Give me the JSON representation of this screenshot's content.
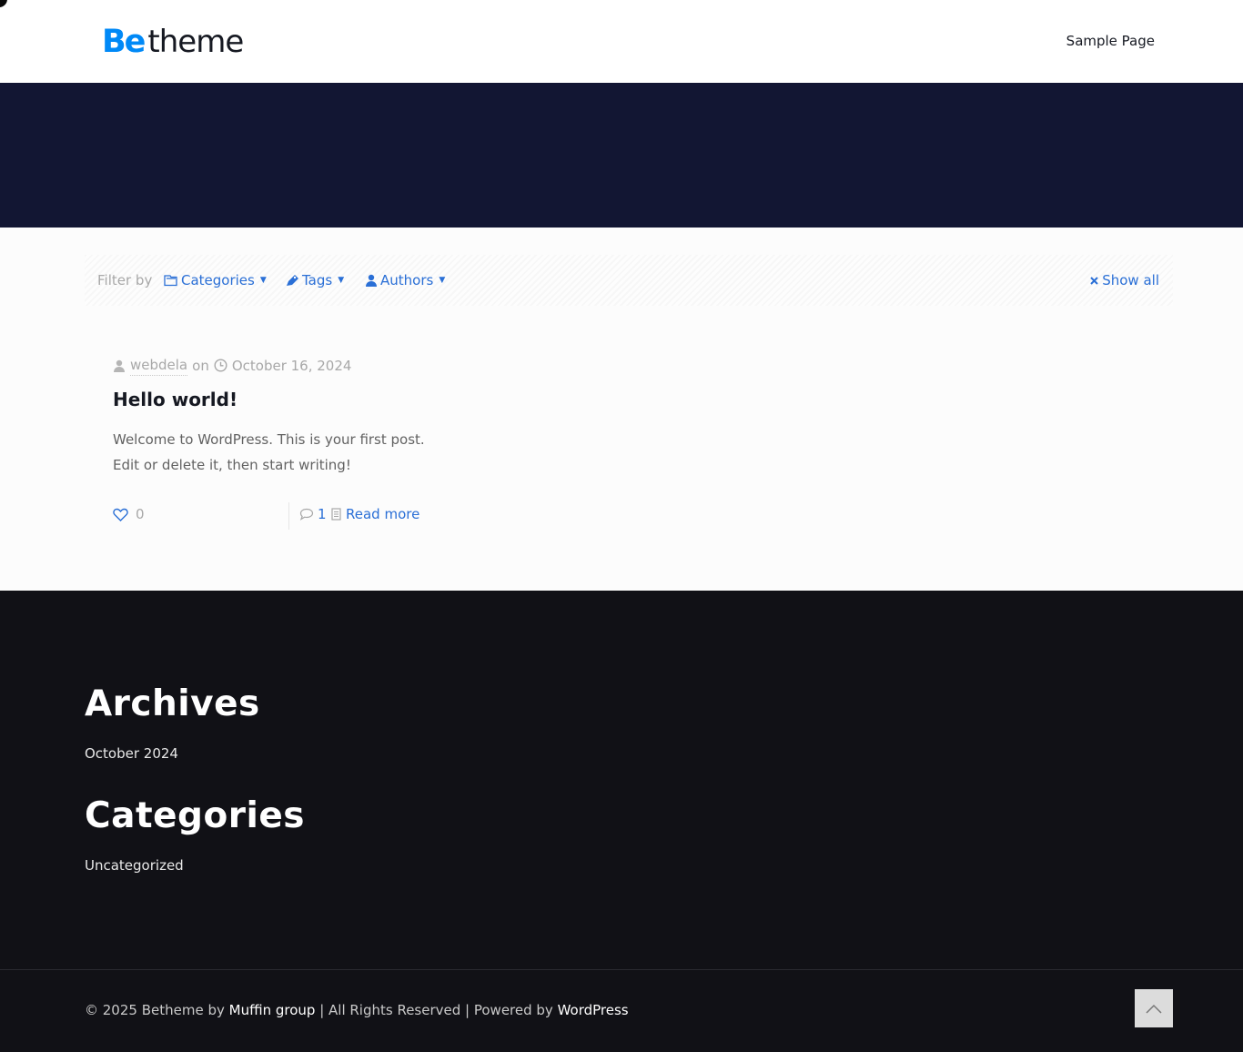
{
  "header": {
    "logo_be": "Be",
    "logo_theme": "theme",
    "nav": [
      {
        "label": "Sample Page"
      }
    ]
  },
  "filters": {
    "filter_by": "Filter by",
    "categories": "Categories",
    "tags": "Tags",
    "authors": "Authors",
    "show_all": "Show all"
  },
  "post": {
    "author": "webdela",
    "on": "on",
    "date": "October 16, 2024",
    "title": "Hello world!",
    "excerpt_line1": "Welcome to WordPress. This is your first post.",
    "excerpt_line2": "Edit or delete it, then start writing!",
    "likes": "0",
    "comments": "1",
    "read_more": "Read more"
  },
  "footer": {
    "archives_title": "Archives",
    "archives": [
      {
        "label": "October 2024"
      }
    ],
    "categories_title": "Categories",
    "categories": [
      {
        "label": "Uncategorized"
      }
    ],
    "copyright_prefix": "© 2025 Betheme by ",
    "muffin": "Muffin group",
    "copyright_mid": " | All Rights Reserved | Powered by ",
    "wordpress": "WordPress"
  },
  "colors": {
    "accent": "#2a6fd6",
    "logo_blue": "#0089f7",
    "hero_bg": "#121633",
    "footer_bg": "#111116"
  }
}
